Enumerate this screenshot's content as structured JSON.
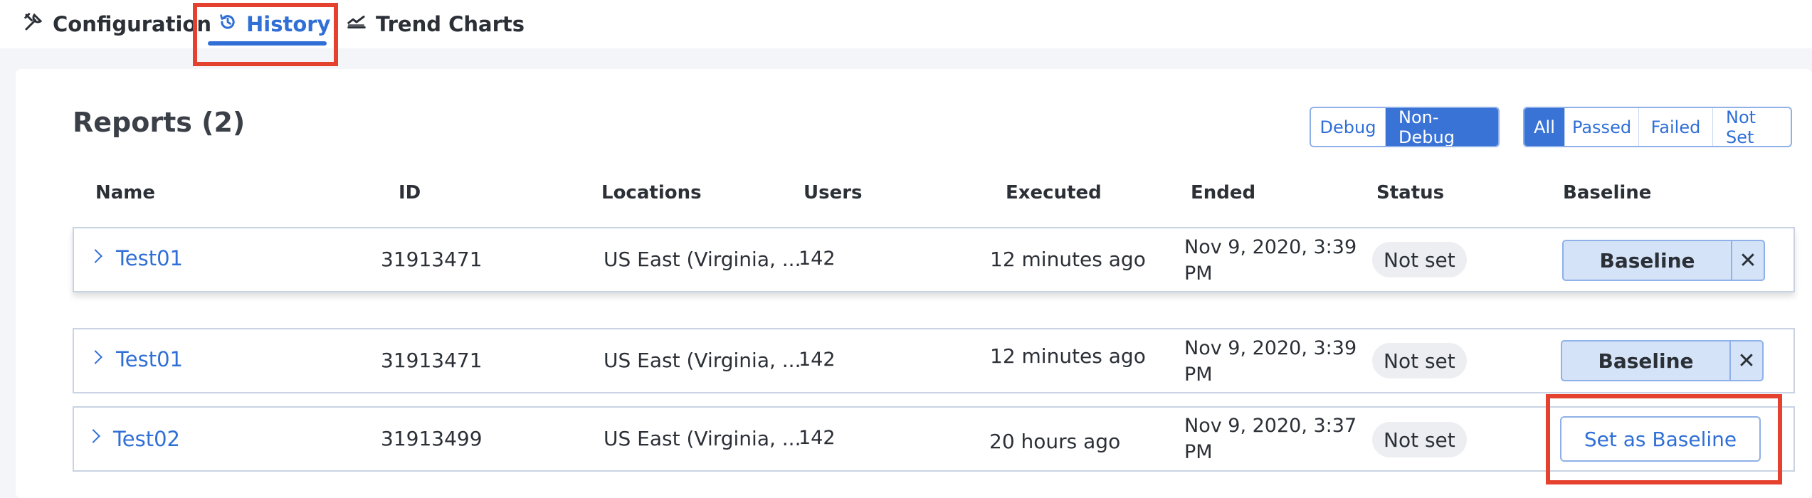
{
  "tabs": [
    {
      "label": "Configuration",
      "icon": "tools-icon",
      "active": false
    },
    {
      "label": "History",
      "icon": "history-icon",
      "active": true
    },
    {
      "label": "Trend Charts",
      "icon": "trend-chart-icon",
      "active": false
    }
  ],
  "reports": {
    "title": "Reports (2)",
    "mode_filter": [
      "Debug",
      "Non-Debug"
    ],
    "mode_selected": "Non-Debug",
    "status_filter": [
      "All",
      "Passed",
      "Failed",
      "Not Set"
    ],
    "status_selected": "All",
    "columns": [
      "Name",
      "ID",
      "Locations",
      "Users",
      "Executed",
      "Ended",
      "Status",
      "Baseline"
    ],
    "baseline_row": {
      "name": "Test01",
      "id": "31913471",
      "locations": "US East (Virginia, ...",
      "users": "142",
      "executed": "12 minutes ago",
      "ended_line1": "Nov 9, 2020, 3:39",
      "ended_line2": "PM",
      "status": "Not set",
      "baseline_label": "Baseline",
      "remove_label": "✕"
    },
    "rows": [
      {
        "name": "Test01",
        "id": "31913471",
        "locations": "US East (Virginia, ...",
        "users": "142",
        "executed": "12 minutes ago",
        "ended_line1": "Nov 9, 2020, 3:39",
        "ended_line2": "PM",
        "status": "Not set",
        "baseline_label": "Baseline",
        "remove_label": "✕"
      },
      {
        "name": "Test02",
        "id": "31913499",
        "locations": "US East (Virginia, ...",
        "users": "142",
        "executed": "20 hours ago",
        "ended_line1": "Nov 9, 2020, 3:37",
        "ended_line2": "PM",
        "status": "Not set",
        "action_label": "Set as Baseline"
      }
    ]
  },
  "colors": {
    "accent": "#2f6fd6",
    "highlight": "#e5412f",
    "baseline_fill": "#d4e3f8"
  }
}
